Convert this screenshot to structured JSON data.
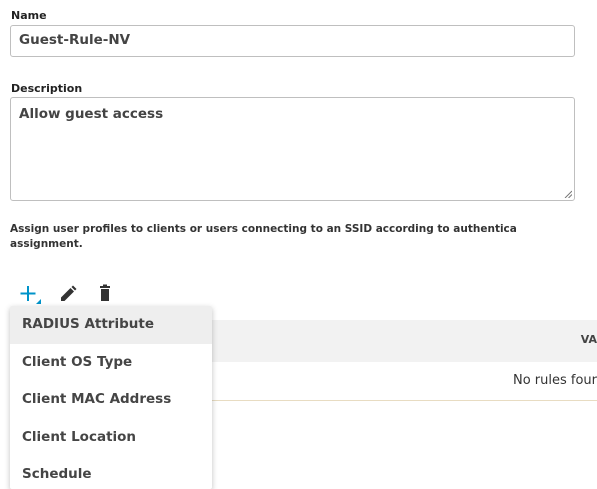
{
  "form": {
    "name_label": "Name",
    "name_value": "Guest-Rule-NV",
    "description_label": "Description",
    "description_value": "Allow guest access"
  },
  "assign": {
    "line1": "Assign user profiles to clients or users connecting to an SSID according to authentica",
    "line2": "assignment."
  },
  "toolbar": {
    "add_icon": "plus-icon",
    "edit_icon": "pencil-icon",
    "delete_icon": "trash-icon",
    "accent_color": "#0093c9"
  },
  "table": {
    "value_header": "VA",
    "empty_message": "No rules four"
  },
  "dropdown": {
    "items": [
      {
        "label": "RADIUS Attribute"
      },
      {
        "label": "Client OS Type"
      },
      {
        "label": "Client MAC Address"
      },
      {
        "label": "Client Location"
      },
      {
        "label": "Schedule"
      }
    ]
  }
}
